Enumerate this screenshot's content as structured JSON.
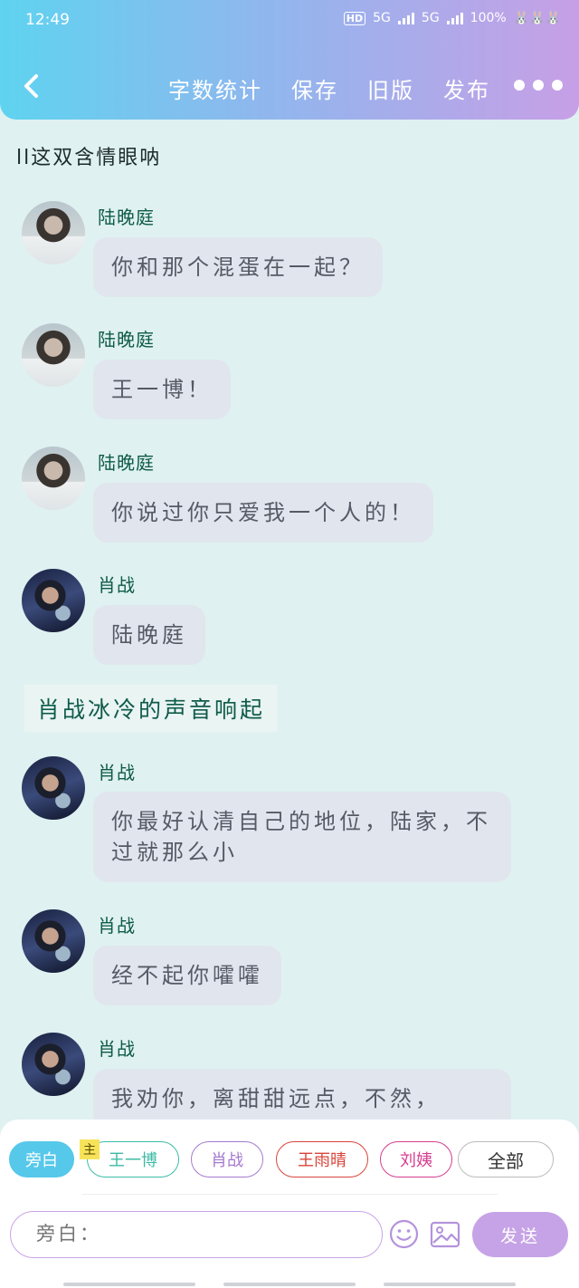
{
  "status": {
    "time": "12:49",
    "hd": "HD",
    "sim1": "5G",
    "sim2": "5G",
    "battery": "100%",
    "bunnies": "🐰🐰🐰"
  },
  "toolbar": {
    "word_count": "字数统计",
    "save": "保存",
    "old_version": "旧版",
    "publish": "发布"
  },
  "doc_title": "ll这双含情眼呐",
  "messages": [
    {
      "sender": "陆晚庭",
      "text": "你和那个混蛋在一起？"
    },
    {
      "sender": "陆晚庭",
      "text": "王一博！"
    },
    {
      "sender": "陆晚庭",
      "text": "你说过你只爱我一个人的！"
    },
    {
      "sender": "肖战",
      "text": "陆晚庭"
    },
    {
      "sender": "肖战",
      "text": "你最好认清自己的地位，陆家，不过就那么小"
    },
    {
      "sender": "肖战",
      "text": "经不起你嚯嚯"
    },
    {
      "sender": "肖战",
      "text": "我劝你，离甜甜远点，不然，"
    }
  ],
  "narration": "肖战冰冷的声音响起",
  "roles": {
    "narrator": "旁白",
    "main_tag": "主",
    "wang": "王一博",
    "xiao": "肖战",
    "wang_yuqing": "王雨晴",
    "liu": "刘姨",
    "all": "全部"
  },
  "role_colors": {
    "narrator": "#56c8ea",
    "wang": "#3dbba6",
    "xiao": "#a57ad0",
    "wang_yuqing": "#d9443a",
    "liu": "#d63c8e",
    "all": "#bbbbbb"
  },
  "composer": {
    "placeholder": "旁白：",
    "send": "发送"
  }
}
